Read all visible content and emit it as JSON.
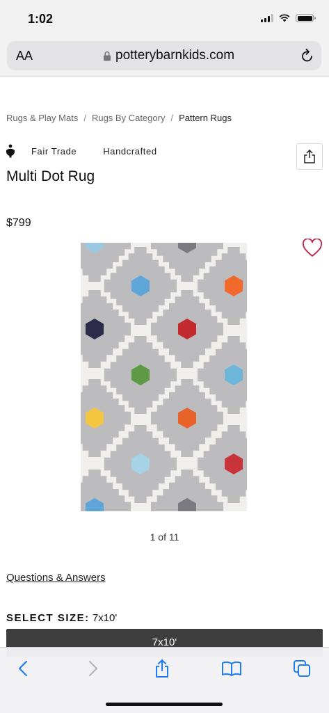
{
  "status": {
    "time": "1:02"
  },
  "browser": {
    "aa_label": "AA",
    "url": "potterybarnkids.com"
  },
  "breadcrumb": [
    "Rugs & Play Mats",
    "Rugs By Category",
    "Pattern Rugs"
  ],
  "badges": {
    "fair_trade": "Fair Trade",
    "handcrafted": "Handcrafted"
  },
  "product": {
    "title": "Multi Dot Rug",
    "price": "$799",
    "image_counter": "1 of 11"
  },
  "links": {
    "questions": "Questions & Answers"
  },
  "size": {
    "label": "SELECT SIZE:",
    "selected": "7x10'",
    "option": "7x10'"
  },
  "colors": {
    "rug_base": "#f1efec",
    "rug_grey": "#bcbcbf",
    "dots": [
      "#9bc9e3",
      "#5fa6d8",
      "#ef6a2b",
      "#2c2b4a",
      "#c32a2f",
      "#5e9a45",
      "#6db6d9",
      "#f4c63f",
      "#e9622a",
      "#a6d2e6",
      "#c9333a",
      "#7a7a80"
    ]
  },
  "icons": [
    "lock-icon",
    "reload-icon",
    "fair-trade-icon",
    "share-icon",
    "heart-icon",
    "back-icon",
    "forward-icon",
    "share-icon",
    "bookmarks-icon",
    "tabs-icon"
  ]
}
